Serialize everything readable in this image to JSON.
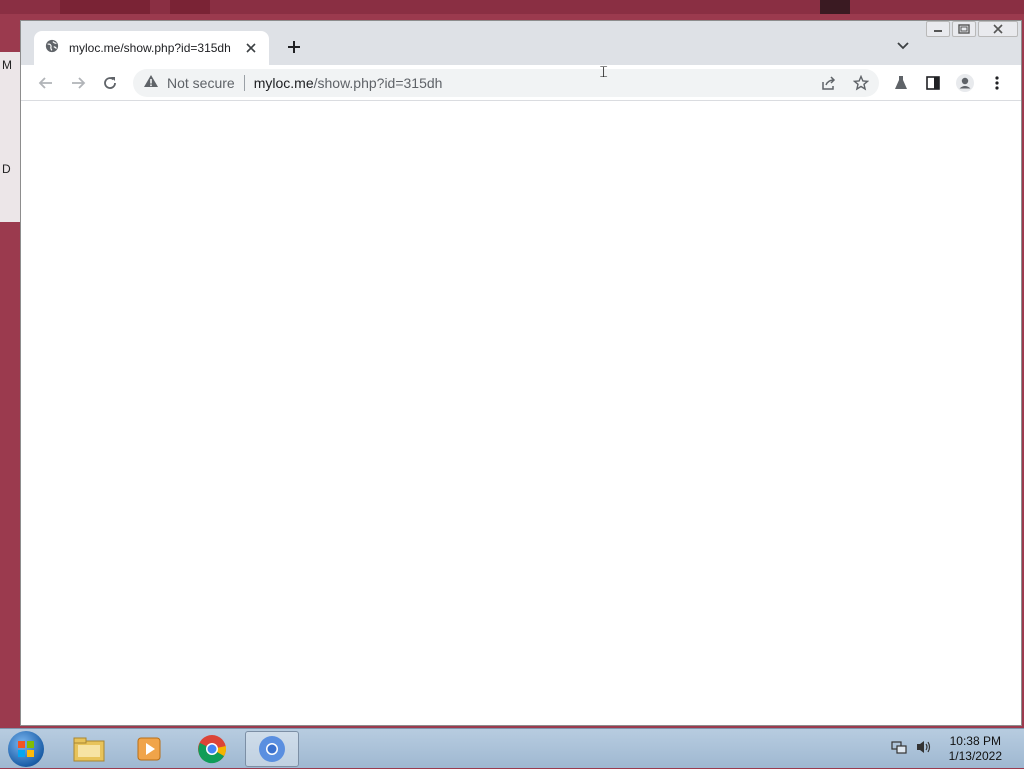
{
  "desktop": {
    "left_letters": [
      "M",
      "D"
    ]
  },
  "browser": {
    "tab": {
      "title": "myloc.me/show.php?id=315dh",
      "icon": "globe-icon"
    },
    "address_bar": {
      "security_label": "Not secure",
      "url_host": "myloc.me",
      "url_path": "/show.php?id=315dh"
    },
    "icons": {
      "back": "arrow-left-icon",
      "forward": "arrow-right-icon",
      "reload": "reload-icon",
      "warning": "warning-icon",
      "share": "share-icon",
      "bookmark": "star-icon",
      "labs": "flask-icon",
      "side_panel": "side-panel-icon",
      "profile": "profile-icon",
      "menu": "kebab-menu-icon"
    }
  },
  "taskbar": {
    "clock_time": "10:38 PM",
    "clock_date": "1/13/2022",
    "pinned": [
      "file-explorer-icon",
      "media-player-icon",
      "chrome-icon",
      "chromium-icon"
    ]
  },
  "colors": {
    "desktop": "#9b3a4e",
    "tab_strip": "#dee1e6",
    "omnibox": "#f1f3f4"
  }
}
